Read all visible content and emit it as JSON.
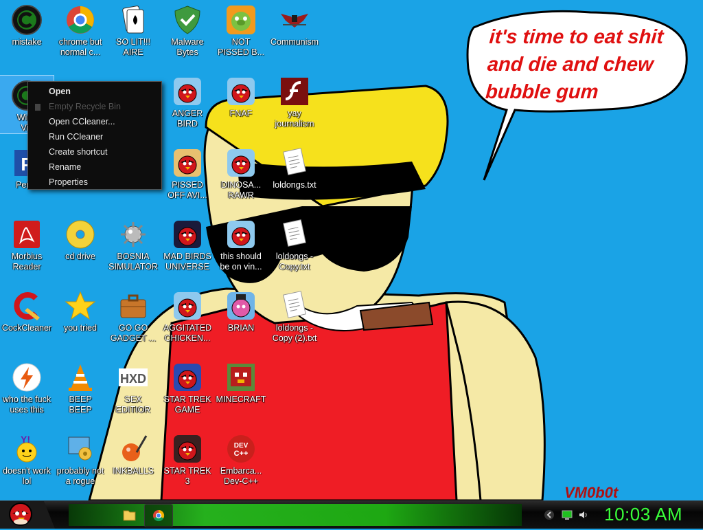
{
  "wallpaper": {
    "speech_bubble": "it's time to eat shit and die and chew bubble gum",
    "signature": "VM0b0t",
    "bg_color": "#1aa3e6"
  },
  "icons": [
    {
      "id": "mistake",
      "label": "mistake",
      "icon": "ccleaner-dark-icon"
    },
    {
      "id": "chrome",
      "label": "chrome but\nnormal c...",
      "icon": "chrome-icon"
    },
    {
      "id": "solit",
      "label": "SO LIT!!!\nAIRE",
      "icon": "solitaire-icon"
    },
    {
      "id": "malware",
      "label": "Malware\nBytes",
      "icon": "shield-check-icon"
    },
    {
      "id": "notpissed",
      "label": "NOT\nPISSED B...",
      "icon": "bad-piggies-icon"
    },
    {
      "id": "communism",
      "label": "Communism",
      "icon": "eagle-emblem-icon"
    },
    {
      "id": "windvis",
      "label": "Wind\nVis",
      "icon": "ccleaner-dark-icon"
    },
    {
      "id": "angerbird",
      "label": "ANGER\nBIRD",
      "icon": "angry-bird-icon"
    },
    {
      "id": "fnaf",
      "label": "FNAF",
      "icon": "angry-bird-icon"
    },
    {
      "id": "journalism",
      "label": "yay\njournalism",
      "icon": "flash-icon"
    },
    {
      "id": "pertis",
      "label": "Pertis",
      "icon": "p-app-icon"
    },
    {
      "id": "pissedoff",
      "label": "PISSED\nOFF AVI...",
      "icon": "angry-birds-seasons-icon"
    },
    {
      "id": "dinosaur",
      "label": "DINOSA...\nRAWR",
      "icon": "angry-bird-icon"
    },
    {
      "id": "loldongs",
      "label": "loldongs.txt",
      "icon": "text-file-icon"
    },
    {
      "id": "morbius",
      "label": "Morbius\nReader",
      "icon": "pdf-reader-icon"
    },
    {
      "id": "cddrive",
      "label": "cd drive",
      "icon": "cd-icon"
    },
    {
      "id": "bosnia",
      "label": "BOSNIA\nSIMULATOR",
      "icon": "mine-icon"
    },
    {
      "id": "madbirds",
      "label": "MAD BIRDS\nUNIVERSE",
      "icon": "angry-birds-space-icon"
    },
    {
      "id": "thisshould",
      "label": "this should\nbe on vin...",
      "icon": "angry-bird-icon"
    },
    {
      "id": "loldongscopy",
      "label": "loldongs -\nCopy.txt",
      "icon": "text-file-icon"
    },
    {
      "id": "cockcleaner",
      "label": "CockCleaner",
      "icon": "ccleaner-icon"
    },
    {
      "id": "youtried",
      "label": "you tried",
      "icon": "star-icon"
    },
    {
      "id": "gogo",
      "label": "GO GO\nGADGET ...",
      "icon": "briefcase-icon"
    },
    {
      "id": "agitated",
      "label": "AGGITATED\nCHICKEN...",
      "icon": "angry-bird-icon"
    },
    {
      "id": "brian",
      "label": "BRIAN",
      "icon": "angry-birds-stella-icon"
    },
    {
      "id": "loldongscopy2",
      "label": "loldongs -\nCopy (2).txt",
      "icon": "text-file-icon"
    },
    {
      "id": "whothefuck",
      "label": "who the fuck\nuses this",
      "icon": "lightning-icon"
    },
    {
      "id": "beepbeep",
      "label": "BEEP\nBEEP",
      "icon": "vlc-cone-icon"
    },
    {
      "id": "sexeditor",
      "label": "SEX\nEDITIOR",
      "icon": "hxd-icon"
    },
    {
      "id": "startrek",
      "label": "STAR TREK\nGAME",
      "icon": "angry-birds-star-wars-icon"
    },
    {
      "id": "minecraft",
      "label": "MINECRAFT",
      "icon": "minecraft-bird-icon"
    },
    {
      "id": "doesntwork",
      "label": "doesn't work\nlol",
      "icon": "yahoo-messenger-icon"
    },
    {
      "id": "rogue",
      "label": "probably not\na rogue",
      "icon": "gear-monitor-icon"
    },
    {
      "id": "inkballs",
      "label": "INKBALLS",
      "icon": "inkball-icon"
    },
    {
      "id": "startrek3",
      "label": "STAR TREK\n3",
      "icon": "angry-birds-star-wars-2-icon"
    },
    {
      "id": "devcpp",
      "label": "Embarca...\nDev-C++",
      "icon": "dev-cpp-icon"
    }
  ],
  "context_menu": {
    "items": [
      {
        "label": "Open",
        "style": "bold"
      },
      {
        "label": "Empty Recycle Bin",
        "style": "disabled"
      },
      {
        "label": "Open CCleaner...",
        "style": ""
      },
      {
        "label": "Run CCleaner",
        "style": ""
      },
      {
        "label": "Create shortcut",
        "style": ""
      },
      {
        "label": "Rename",
        "style": ""
      },
      {
        "label": "Properties",
        "style": ""
      }
    ]
  },
  "taskbar": {
    "clock": "10:03 AM",
    "start_icon": "angry-bird-start-icon",
    "pinned": [
      "folder-icon",
      "chrome-icon"
    ],
    "tray": [
      "chevron-icon",
      "network-icon",
      "volume-icon"
    ],
    "accent": "#3aff3a"
  }
}
